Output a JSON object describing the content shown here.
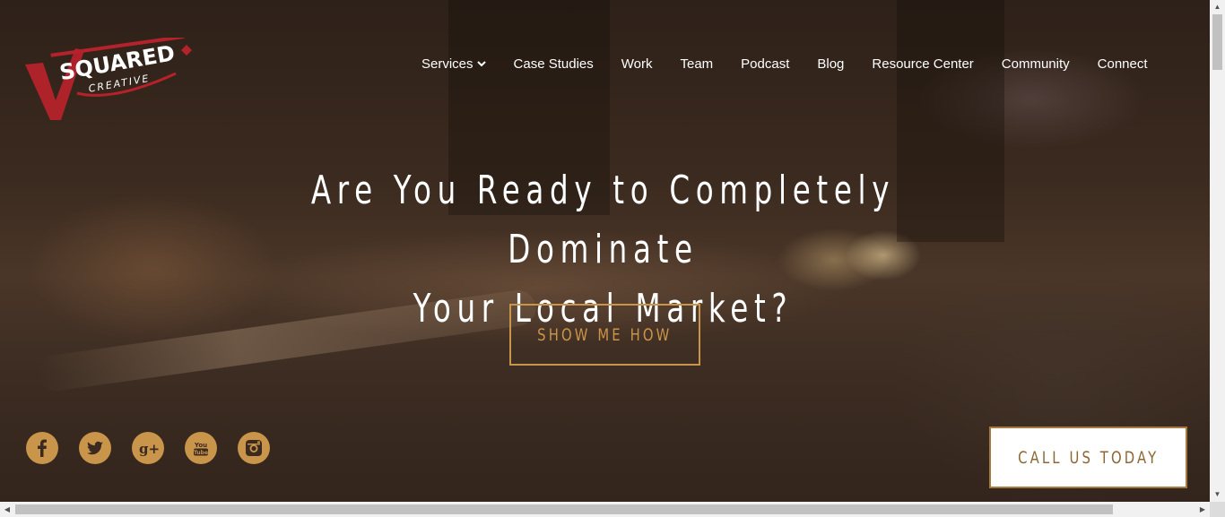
{
  "logo": {
    "brand_word": "SQUARED",
    "tagline": "CREATIVE",
    "initial": "V",
    "colors": {
      "red": "#b5222b",
      "white": "#ffffff"
    }
  },
  "nav": {
    "items": [
      {
        "label": "Services",
        "has_dropdown": true
      },
      {
        "label": "Case Studies"
      },
      {
        "label": "Work"
      },
      {
        "label": "Team"
      },
      {
        "label": "Podcast"
      },
      {
        "label": "Blog"
      },
      {
        "label": "Resource Center"
      },
      {
        "label": "Community"
      },
      {
        "label": "Connect"
      }
    ]
  },
  "hero": {
    "headline_line1": "Are You Ready to Completely Dominate",
    "headline_line2": "Your Local Market?",
    "cta_label": "SHOW ME HOW"
  },
  "social": {
    "items": [
      {
        "icon": "facebook-icon",
        "glyph": "f"
      },
      {
        "icon": "twitter-icon",
        "glyph": ""
      },
      {
        "icon": "google-plus-icon",
        "glyph": "g+"
      },
      {
        "icon": "youtube-icon",
        "glyph": "You Tube"
      },
      {
        "icon": "instagram-icon",
        "glyph": ""
      }
    ]
  },
  "call_button": {
    "label": "CALL US TODAY"
  },
  "colors": {
    "accent_gold": "#c8954a",
    "text_white": "#ffffff",
    "call_text": "#8c6734"
  }
}
